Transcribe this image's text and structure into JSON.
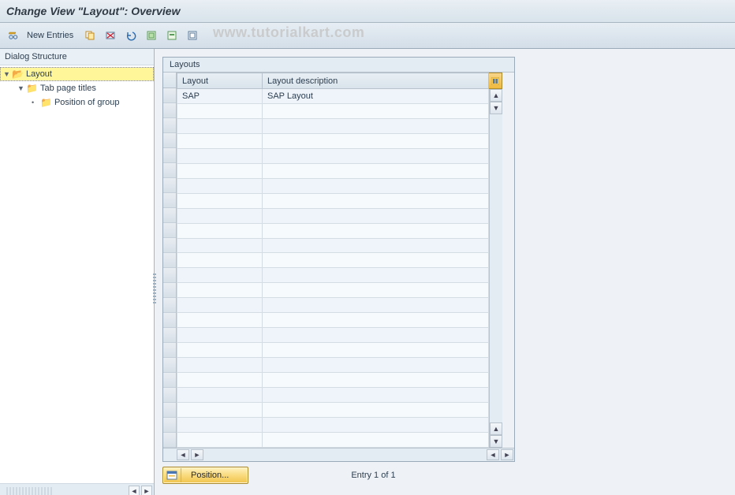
{
  "title": "Change View \"Layout\": Overview",
  "toolbar": {
    "new_entries_label": "New Entries"
  },
  "watermark": "www.tutorialkart.com",
  "sidebar": {
    "header": "Dialog Structure",
    "node0": "Layout",
    "node1": "Tab page titles",
    "node2": "Position of group"
  },
  "panel": {
    "title": "Layouts",
    "col_layout": "Layout",
    "col_desc": "Layout description",
    "rows": [
      {
        "layout": "SAP",
        "desc": "SAP Layout"
      }
    ],
    "row0_layout": "SAP",
    "row0_desc": "SAP Layout"
  },
  "footer": {
    "position_label": "Position...",
    "entry_text": "Entry 1 of 1"
  }
}
